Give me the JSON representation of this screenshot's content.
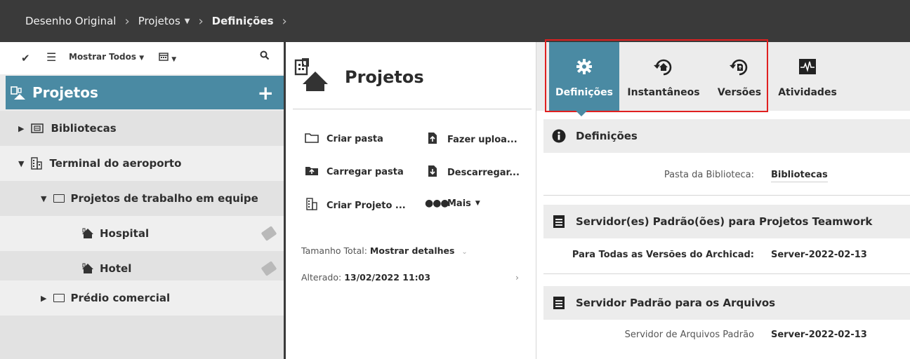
{
  "breadcrumb": {
    "items": [
      {
        "label": "Desenho Original",
        "has_caret": false
      },
      {
        "label": "Projetos",
        "has_caret": true
      },
      {
        "label": "Definições",
        "has_caret": false
      }
    ]
  },
  "left": {
    "toolbar": {
      "filter_label": "Mostrar Todos"
    },
    "header": {
      "title": "Projetos",
      "add_label": "+"
    },
    "tree": [
      {
        "label": "Bibliotecas"
      },
      {
        "label": "Terminal do aeroporto"
      },
      {
        "label": "Projetos de trabalho em equipe"
      },
      {
        "label": "Hospital"
      },
      {
        "label": "Hotel"
      },
      {
        "label": "Prédio comercial"
      }
    ]
  },
  "middle": {
    "title": "Projetos",
    "actions": [
      {
        "label": "Criar pasta",
        "icon": "folder-icon"
      },
      {
        "label": "Fazer uploa...",
        "icon": "upload-icon"
      },
      {
        "label": "Carregar pasta",
        "icon": "upload-folder-icon"
      },
      {
        "label": "Descarregar...",
        "icon": "download-icon"
      },
      {
        "label": "Criar Projeto ...",
        "icon": "building-icon"
      },
      {
        "label": "Mais",
        "icon": "more-icon"
      }
    ],
    "size_label": "Tamanho Total:",
    "size_link": "Mostrar detalhes",
    "modified_label": "Alterado:",
    "modified_value": "13/02/2022 11:03"
  },
  "right": {
    "tabs": [
      {
        "label": "Definições",
        "icon": "gear-icon",
        "active": true
      },
      {
        "label": "Instantâneos",
        "icon": "snapshot-icon",
        "active": false
      },
      {
        "label": "Versões",
        "icon": "versions-icon",
        "active": false
      },
      {
        "label": "Atividades",
        "icon": "activity-icon",
        "active": false
      }
    ],
    "sections": [
      {
        "title": "Definições",
        "icon": "info-icon",
        "rows": [
          {
            "key": "Pasta da Biblioteca:",
            "value": "Bibliotecas"
          }
        ]
      },
      {
        "title": "Servidor(es) Padrão(ões) para Projetos Teamwork",
        "icon": "server-icon",
        "rows": [
          {
            "key": "Para Todas as Versões do Archicad:",
            "value": "Server-2022-02-13"
          }
        ]
      },
      {
        "title": "Servidor Padrão para os Arquivos",
        "icon": "server-icon",
        "rows": [
          {
            "key": "Servidor de Arquivos Padrão",
            "value": "Server-2022-02-13"
          }
        ]
      }
    ]
  },
  "colors": {
    "accent": "#4a8aa3",
    "topbar": "#3a3a3a",
    "highlight": "#e02020"
  }
}
